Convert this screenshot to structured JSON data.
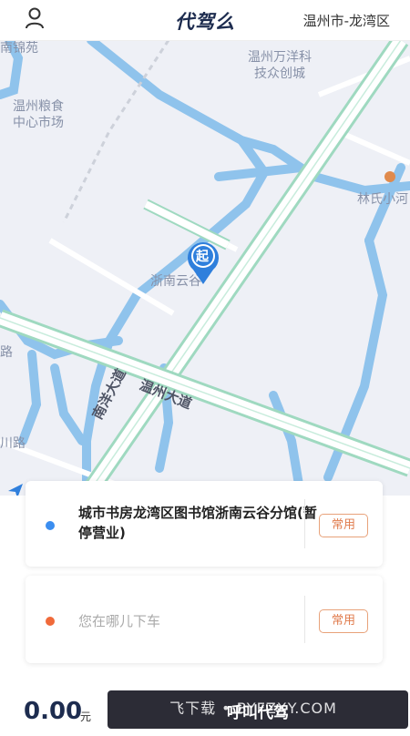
{
  "header": {
    "app_title": "代驾么",
    "city": "温州市-龙湾区"
  },
  "map": {
    "labels": {
      "top_left": "南锦苑",
      "grain_market": "温州粮食\n中心市场",
      "wanyang": "温州万洋科\n技众创城",
      "lin": "林氏小河",
      "zhenan": "浙南云谷",
      "left_edge": "路",
      "left_lower": "川路"
    },
    "roads": {
      "wenzhou_avenue": "温州大道",
      "nanyang_avenue": "南洋大道"
    },
    "marker_label": "起"
  },
  "start": {
    "address": "城市书房龙湾区图书馆浙南云谷分馆(暂停营业)",
    "common_label": "常用"
  },
  "end": {
    "placeholder": "您在哪儿下车",
    "common_label": "常用"
  },
  "bottom": {
    "price": "0.00",
    "unit": "元",
    "call_label": "呼叫代驾"
  },
  "watermark": "飞下载 • BYFZXY.COM",
  "colors": {
    "accent_dark": "#1d2c4f",
    "start_dot": "#3b8ef0",
    "end_dot": "#f06a3a",
    "common_border": "#e8a27a"
  }
}
